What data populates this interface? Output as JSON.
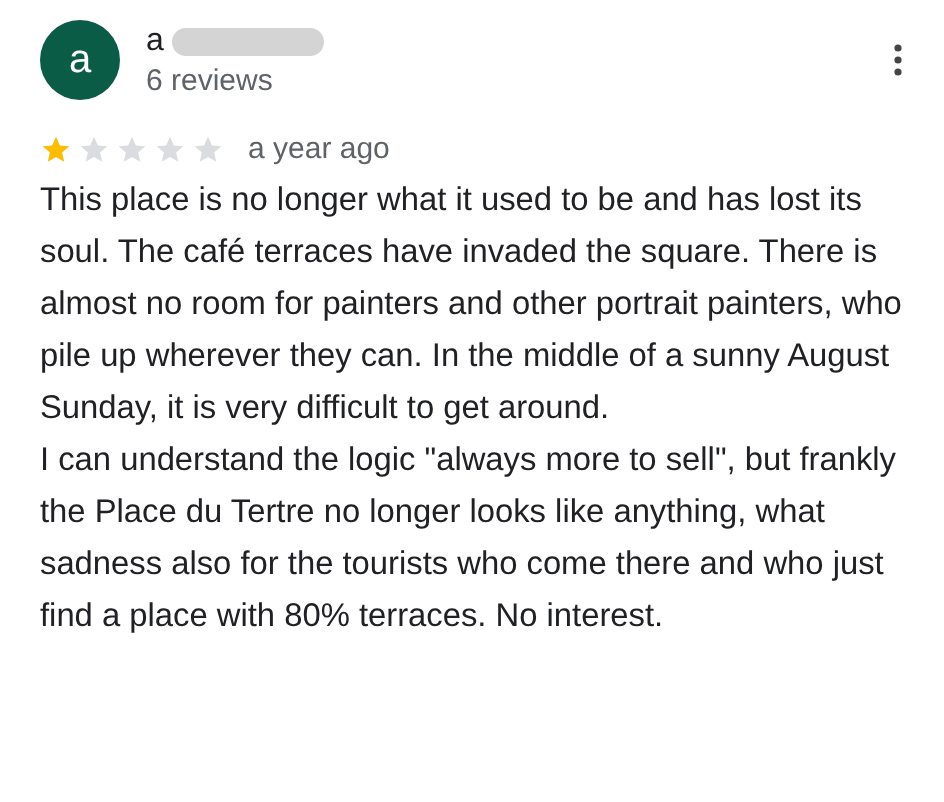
{
  "reviewer": {
    "initial": "a",
    "name": "a",
    "name_redacted": true,
    "meta": "6 reviews"
  },
  "review": {
    "stars": 1,
    "time": "a year ago",
    "paragraphs": [
      "This place is no longer what it used to be and has lost its soul. The café terraces have invaded the square. There is almost no room for painters and other portrait painters, who pile up wherever they can. In the middle of a sunny August Sunday, it is very difficult to get around.",
      "I can understand the logic \"always more to sell\", but frankly the Place du Tertre no longer looks like anything, what sadness also for the tourists who come there and who just find a place with 80% terraces. No interest."
    ]
  }
}
